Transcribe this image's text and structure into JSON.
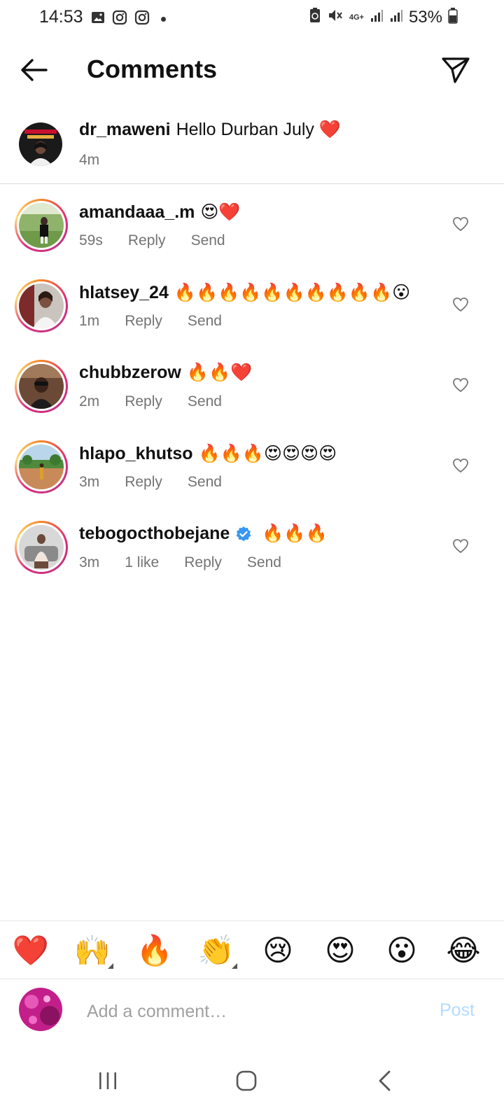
{
  "status_bar": {
    "time": "14:53",
    "battery": "53%",
    "network": "4G+"
  },
  "header": {
    "title": "Comments"
  },
  "caption": {
    "username": "dr_maweni",
    "text": "Hello Durban July ❤️",
    "time": "4m"
  },
  "comments": [
    {
      "username": "amandaaa_.m",
      "text": "😍❤️",
      "time": "59s",
      "reply": "Reply",
      "send": "Send"
    },
    {
      "username": "hlatsey_24",
      "text": "🔥🔥🔥🔥🔥🔥🔥🔥🔥🔥😮",
      "time": "1m",
      "reply": "Reply",
      "send": "Send"
    },
    {
      "username": "chubbzerow",
      "text": "🔥🔥❤️",
      "time": "2m",
      "reply": "Reply",
      "send": "Send"
    },
    {
      "username": "hlapo_khutso",
      "text": "🔥🔥🔥😍😍😍😍",
      "time": "3m",
      "reply": "Reply",
      "send": "Send"
    },
    {
      "username": "tebogocthobejane",
      "text": "🔥🔥🔥",
      "time": "3m",
      "likes": "1 like",
      "reply": "Reply",
      "send": "Send",
      "verified": true
    }
  ],
  "emoji_bar": [
    "❤️",
    "🙌",
    "🔥",
    "👏",
    "😢",
    "😍",
    "😮",
    "😂"
  ],
  "composer": {
    "placeholder": "Add a comment…",
    "post_label": "Post"
  },
  "colors": {
    "accent_post_disabled": "#b3dbff",
    "meta_gray": "#737373",
    "verified_blue": "#3897f0"
  }
}
